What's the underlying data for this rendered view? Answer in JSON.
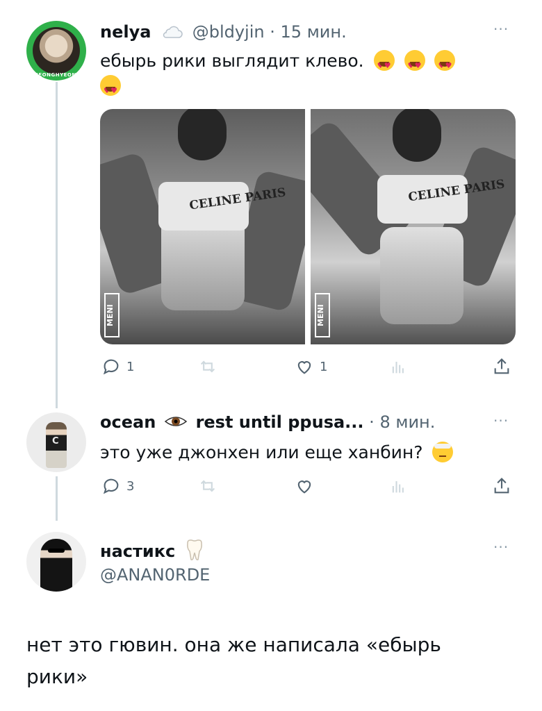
{
  "tweets": [
    {
      "display_name": "nelya",
      "badge_icon": "cloud-icon",
      "handle": "@bldyjin",
      "separator": "·",
      "time": "15 мин.",
      "more": "···",
      "text": "ебырь рики выглядит клево.",
      "emojis": [
        "heart-eyes-emoji",
        "heart-eyes-emoji",
        "heart-eyes-emoji",
        "heart-eyes-emoji"
      ],
      "avatar_text": "JEONGHYEON",
      "media_labels": [
        "CELINE PARIS",
        "CELINE PARIS"
      ],
      "media_brand": "MENI",
      "stats": {
        "replies": "1",
        "retweets": "",
        "likes": "1",
        "views": ""
      }
    },
    {
      "display_name": "ocean",
      "name_emoji": "eye-emoji",
      "name_suffix": "rest until ppusa...",
      "separator": "·",
      "time": "8 мин.",
      "more": "···",
      "text": "это уже джонхен или еще ханбин?",
      "emoji": "head-bandage-emoji",
      "stats": {
        "replies": "3",
        "retweets": "",
        "likes": "",
        "views": ""
      }
    },
    {
      "display_name": "настикс",
      "name_emoji": "tooth-emoji",
      "handle": "@ANAN0RDE",
      "more": "···",
      "text_line1": "нет это гювин. она же написала «ебырь",
      "text_line2": "рики»"
    }
  ],
  "colors": {
    "text": "#0f1419",
    "muted": "#536471",
    "thread_line": "#cfd9de",
    "avatar_ring": "#2fb04a"
  }
}
